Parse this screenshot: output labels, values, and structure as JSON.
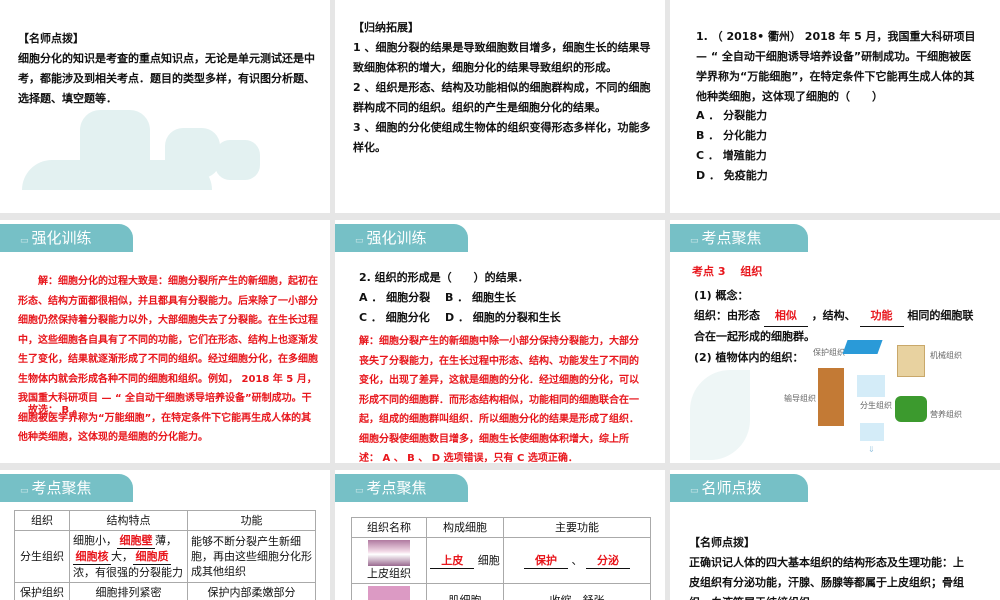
{
  "slide1": {
    "heading": "【名师点拨】",
    "body": "细胞分化的知识是考查的重点知识点，无论是单元测试还是中考，都能涉及到相关考点．题目的类型多样，有识图分析题、选择题、填空题等．"
  },
  "slide2": {
    "heading": "【归纳拓展】",
    "lines": [
      "1 、细胞分裂的结果是导致细胞数目增多，细胞生长的结果导致细胞体积的增大，细胞分化的结果导致组织的形成。",
      "2 、组织是形态、结构及功能相似的细胞群构成，不同的细胞群构成不同的组织。组织的产生是细胞分化的结果。",
      "3 、细胞的分化使组成生物体的组织变得形态多样化，功能多样化。"
    ]
  },
  "slide3": {
    "question": "1. （ 2018• 衢州） 2018 年 5 月，我国重大科研项目 — “ 全自动干细胞诱导培养设备”研制成功。干细胞被医学界称为“万能细胞”，在特定条件下它能再生成人体的其他种类细胞，这体现了细胞的（　　）",
    "options": [
      "A ． 分裂能力",
      "B ． 分化能力",
      "C ． 增殖能力",
      "D ． 免疫能力"
    ]
  },
  "slide4": {
    "tab": "强化训练",
    "answer": "解：细胞分化的过程大致是：细胞分裂所产生的新细胞，起初在形态、结构方面都很相似，并且都具有分裂能力。后来除了一小部分细胞仍然保持着分裂能力以外，大部细胞失去了分裂能。在生长过程中，这些细胞各自具有了不同的功能，它们在形态、结构上也逐渐发生了变化，结果就逐渐形成了不同的组织。经过细胞分化，在多细胞生物体内就会形成各种不同的细胞和组织。例如， 2018 年 5 月，我国重大科研项目 — “ 全自动干细胞诱导培养设备”研制成功。干细胞被医学界称为“万能细胞”，在特定条件下它能再生成人体的其他种类细胞，这体现的是细胞的分化能力。",
    "choice": "故选： B 。"
  },
  "slide5": {
    "tab": "强化训练",
    "question": "2. 组织的形成是（　　）的结果．",
    "options": [
      "A ． 细胞分裂",
      "B ． 细胞生长",
      "C ． 细胞分化",
      "D ． 细胞的分裂和生长"
    ],
    "answer": "解：细胞分裂产生的新细胞中除一小部分保持分裂能力，大部分丧失了分裂能力，在生长过程中形态、结构、功能发生了不同的变化，出现了差异，这就是细胞的分化．经过细胞的分化，可以形成不同的细胞群．而形态结构相似，功能相同的细胞联合在一起，组成的细胞群叫组织．所以细胞分化的结果是形成了组织．细胞分裂使细胞数目增多，细胞生长使细胞体积增大，综上所述： A 、 B 、 D 选项错误，只有 C 选项正确．"
  },
  "slide6": {
    "tab": "考点聚焦",
    "point": "考点 3　 组织",
    "concept": "(1) 概念：",
    "def_a": "组织：由形态",
    "blank1": "相似",
    "def_b": "，结构、",
    "blank2": "功能",
    "def_c": "相同的细胞联合在一起形成的细胞群。",
    "plant": "(2) 植物体内的组织：",
    "labels": {
      "protect": "保护组织",
      "mech": "机械组织",
      "conduct": "输导组织",
      "merist": "分生组织",
      "nutri": "营养组织"
    }
  },
  "slide7": {
    "tab": "考点聚焦",
    "headers": [
      "组织",
      "结构特点",
      "功能"
    ],
    "row1": {
      "name": "分生组织",
      "s1": "细胞小，",
      "b1": "细胞壁",
      "s2": "薄，",
      "b2": "细胞核",
      "s3": "大，",
      "b3": "细胞质",
      "s4": "浓，有很强的分裂能力",
      "func": "能够不断分裂产生新细胞，再由这些细胞分化形成其他组织"
    },
    "row2": [
      "保护组织",
      "细胞排列紧密",
      "保护内部柔嫩部分"
    ]
  },
  "slide8": {
    "tab": "考点聚焦",
    "headers": [
      "组织名称",
      "构成细胞",
      "主要功能"
    ],
    "row1": {
      "name": "上皮组织",
      "blank": "上皮",
      "cell": "细胞",
      "f1": "保护",
      "sep": "、",
      "f2": "分泌"
    },
    "row2": {
      "cell": "肌细胞",
      "func": "收缩、舒张"
    }
  },
  "slide9": {
    "tab": "名师点拨",
    "heading": "【名师点拨】",
    "body": "正确识记人体的四大基本组织的结构形态及生理功能：上皮组织有分泌功能，汗腺、肠腺等都属于上皮组织；骨组织、血液等属于结缔组织．"
  }
}
